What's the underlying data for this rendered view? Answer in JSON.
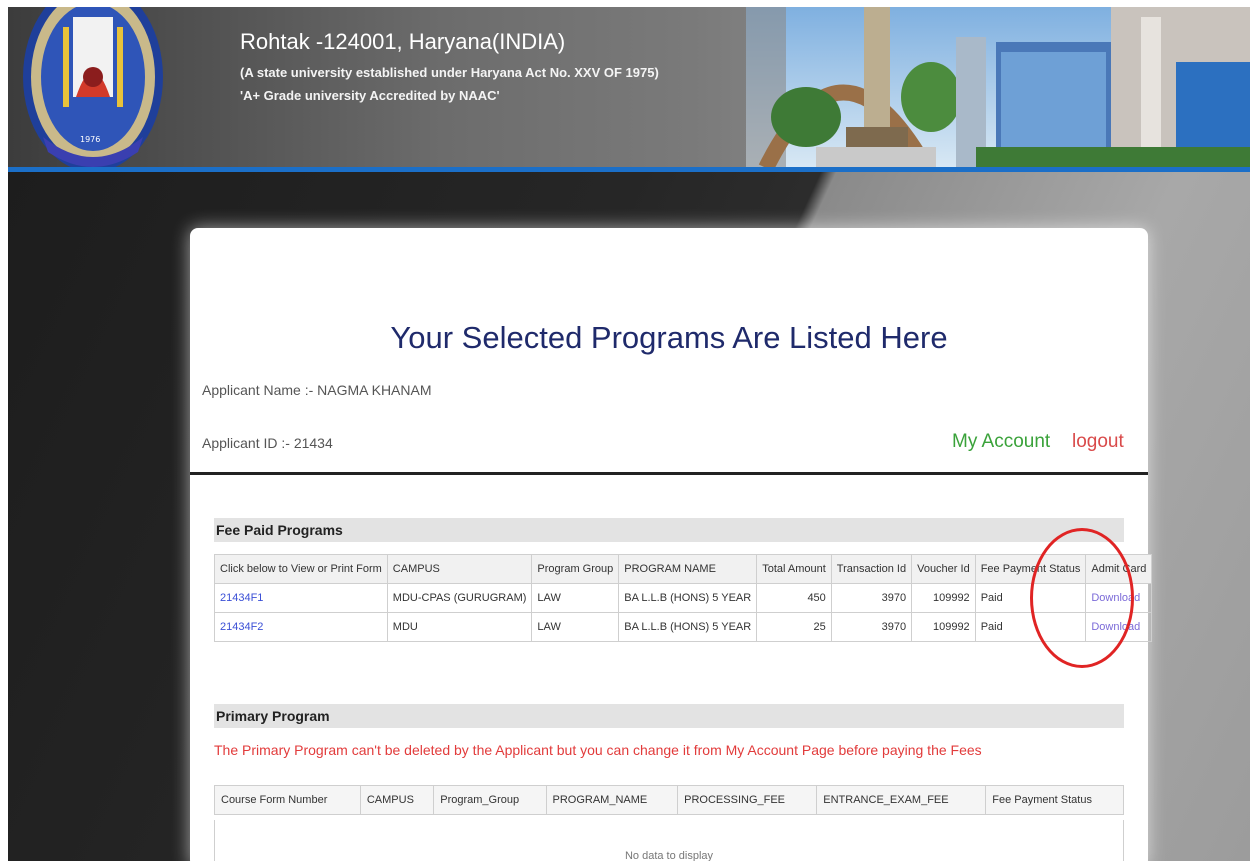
{
  "header": {
    "title": "Rohtak -124001, Haryana(INDIA)",
    "subtitle": "(A state university established under Haryana Act No. XXV OF 1975)",
    "accreditation": "'A+ Grade university Accredited by NAAC'",
    "logo_year": "1976"
  },
  "page": {
    "title": "Your Selected Programs Are Listed Here",
    "applicant_name": "Applicant Name :- NAGMA KHANAM",
    "applicant_id": "Applicant ID :- 21434",
    "my_account": "My Account",
    "logout": "logout"
  },
  "fee_paid": {
    "heading": "Fee Paid  Programs",
    "columns": [
      "Click below to View or Print Form",
      "CAMPUS",
      "Program Group",
      "PROGRAM NAME",
      "Total Amount",
      "Transaction Id",
      "Voucher Id",
      "Fee Payment Status",
      "Admit Card"
    ],
    "rows": [
      {
        "form": "21434F1",
        "campus": "MDU-CPAS (GURUGRAM)",
        "group": "LAW",
        "program": "BA L.L.B (HONS) 5 YEAR",
        "amount": "450",
        "txn": "3970",
        "voucher": "109992",
        "status": "Paid",
        "admit": "Download"
      },
      {
        "form": "21434F2",
        "campus": "MDU",
        "group": "LAW",
        "program": "BA L.L.B (HONS) 5 YEAR",
        "amount": "25",
        "txn": "3970",
        "voucher": "109992",
        "status": "Paid",
        "admit": "Download"
      }
    ]
  },
  "primary": {
    "heading": "Primary Program",
    "note": "The Primary Program can't be deleted by the Applicant but you can change it from My Account Page before paying the Fees",
    "columns": [
      "Course Form Number",
      "CAMPUS",
      "Program_Group",
      "PROGRAM_NAME",
      "PROCESSING_FEE",
      "ENTRANCE_EXAM_FEE",
      "Fee Payment Status"
    ],
    "empty_text": "No data to display"
  },
  "colors": {
    "header_blue_line": "#1b6fc8",
    "title_navy": "#1f2a6b",
    "account_green": "#3aa23a",
    "logout_red": "#d94a4a",
    "note_red": "#e23b3b",
    "annotation_circle": "#e02424"
  }
}
